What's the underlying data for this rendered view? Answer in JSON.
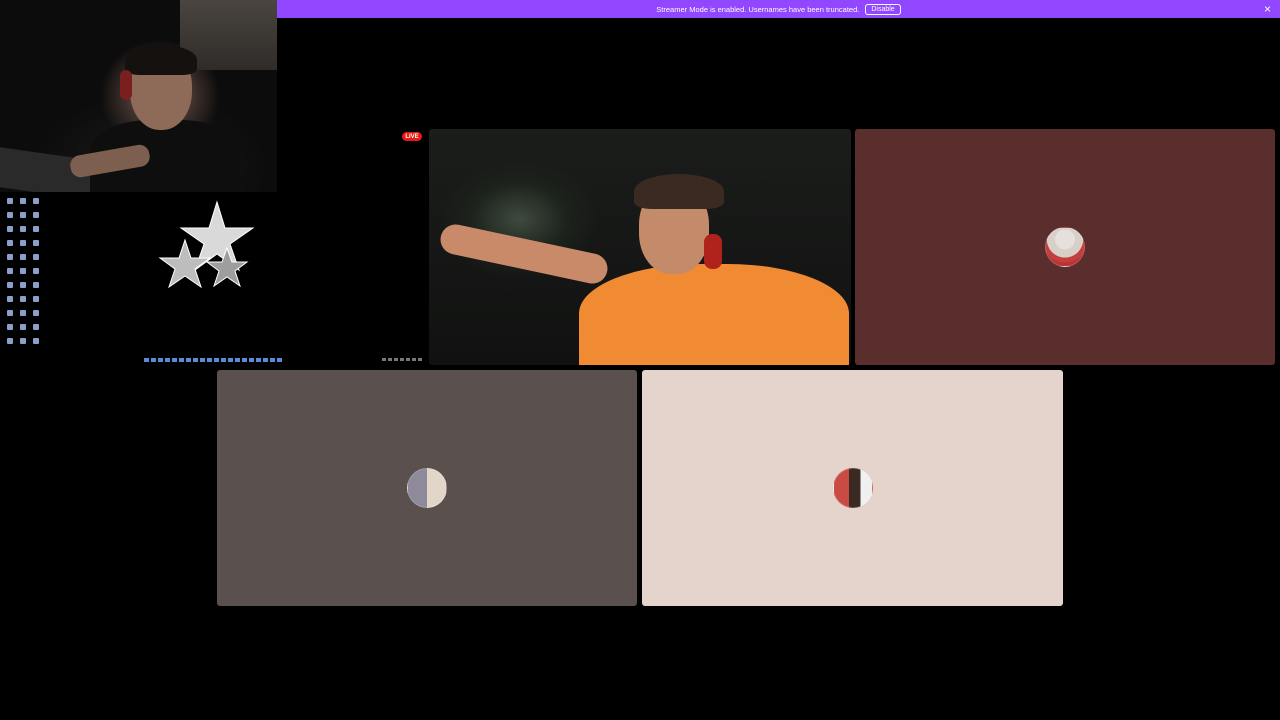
{
  "banner": {
    "message": "Streamer Mode is enabled. Usernames have been truncated.",
    "disable_label": "Disable",
    "close_icon": "×",
    "color": "#9146ff"
  },
  "live_badge": "LIVE",
  "tiles": {
    "main": {
      "type": "video"
    },
    "participant_1": {
      "background": "#5b2e2e",
      "avatar": "cowboy-hat-avatar"
    },
    "participant_2": {
      "background": "#5a504e",
      "avatar": "couple-photo-avatar"
    },
    "participant_3": {
      "background": "#e5d4cb",
      "avatar": "couple-photo-avatar"
    }
  },
  "colors": {
    "live_red": "#e91916",
    "background": "#000000"
  }
}
